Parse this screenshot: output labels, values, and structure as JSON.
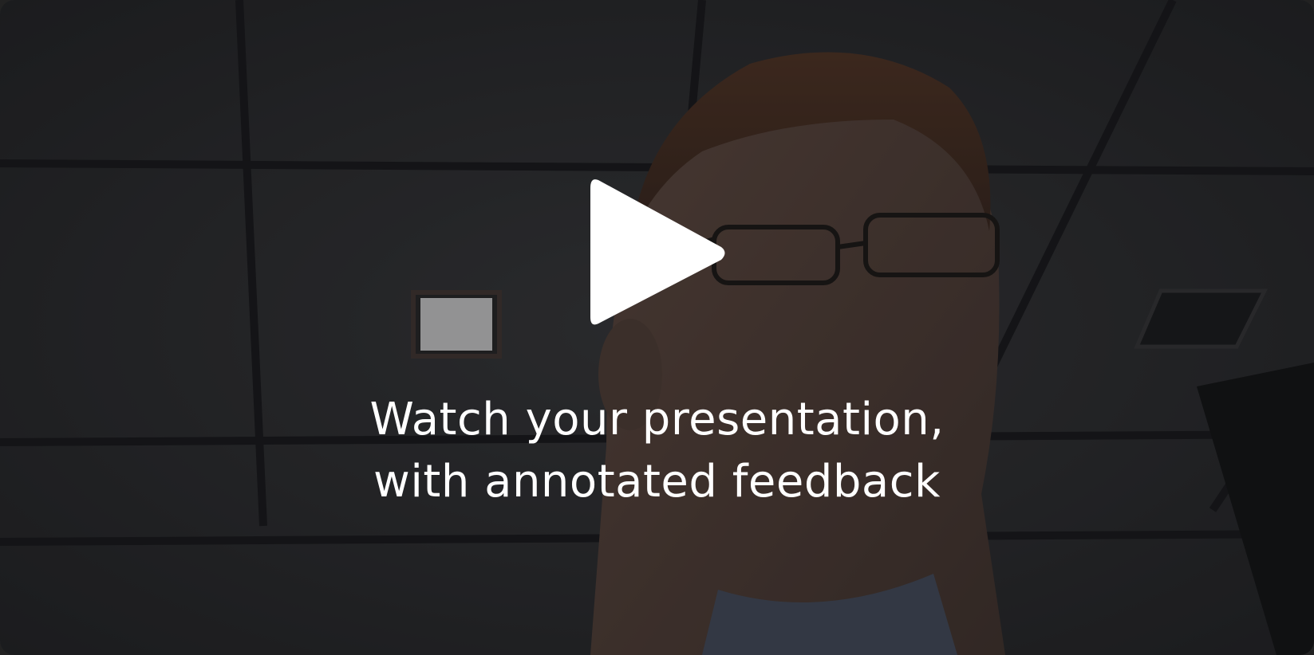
{
  "video": {
    "caption": {
      "line1": "Watch your presentation,",
      "line2": "with annotated feedback"
    },
    "play_icon": "play-icon",
    "overlay_color": "#000000"
  }
}
